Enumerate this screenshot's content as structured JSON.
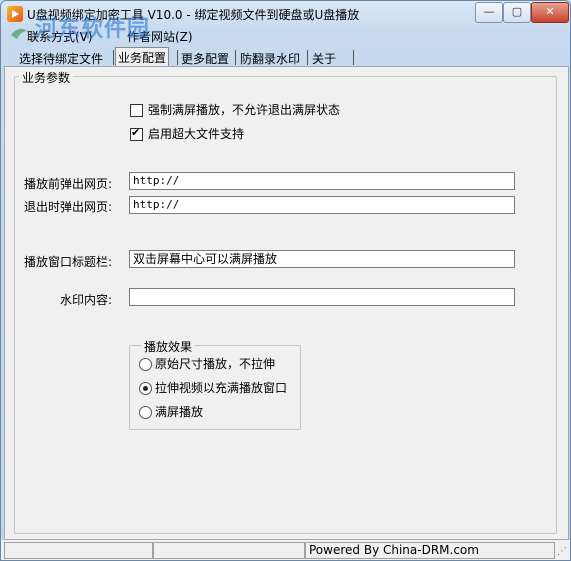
{
  "window": {
    "title": "U盘视频绑定加密工具 V10.0 - 绑定视频文件到硬盘或U盘播放",
    "controls": {
      "minimize": "—",
      "maximize": "▢",
      "close": "✕"
    }
  },
  "watermark": {
    "text": "河东软件园"
  },
  "menu": {
    "items": [
      "联系方式(V)",
      "作者网站(Z)"
    ]
  },
  "tabs": [
    "选择待绑定文件",
    "业务配置",
    "更多配置",
    "防翻录水印",
    "关于"
  ],
  "active_tab": "业务配置",
  "business": {
    "group_label": "业务参数",
    "checkbox_fullscreen": {
      "label": "强制满屏播放，不允许退出满屏状态",
      "checked": false
    },
    "checkbox_bigfile": {
      "label": "启用超大文件支持",
      "checked": true
    },
    "before_play_label": "播放前弹出网页:",
    "before_play_value": "http://",
    "on_exit_label": "退出时弹出网页:",
    "on_exit_value": "http://",
    "window_title_label": "播放窗口标题栏:",
    "window_title_value": "双击屏幕中心可以满屏播放",
    "watermark_label": "水印内容:",
    "watermark_value": ""
  },
  "playback": {
    "group_label": "播放效果",
    "options": [
      {
        "label": "原始尺寸播放，不拉伸",
        "selected": false
      },
      {
        "label": "拉伸视频以充满播放窗口",
        "selected": true
      },
      {
        "label": "满屏播放",
        "selected": false
      }
    ]
  },
  "status": {
    "text": "Powered By China-DRM.com"
  }
}
